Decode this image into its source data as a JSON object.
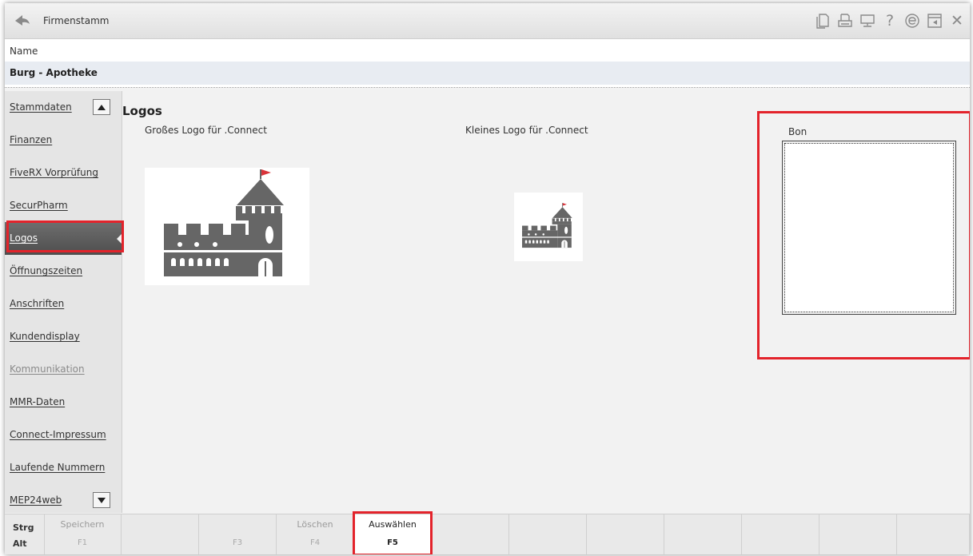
{
  "window": {
    "title": "Firmenstamm"
  },
  "toolbar_icons": [
    "document-icon",
    "print-icon",
    "monitor-icon",
    "help-icon",
    "edge-icon",
    "minimize-icon",
    "close-icon"
  ],
  "toolbar_glyphs": {
    "help": "?",
    "close": "✕"
  },
  "header": {
    "name_label": "Name",
    "name_value": "Burg - Apotheke"
  },
  "sidebar": {
    "items": [
      {
        "label": "Stammdaten"
      },
      {
        "label": "Finanzen"
      },
      {
        "label": "FiveRX Vorprüfung"
      },
      {
        "label": "SecurPharm"
      },
      {
        "label": "Logos"
      },
      {
        "label": "Öffnungszeiten"
      },
      {
        "label": "Anschriften"
      },
      {
        "label": "Kundendisplay"
      },
      {
        "label": "Kommunikation"
      },
      {
        "label": "MMR-Daten"
      },
      {
        "label": "Connect-Impressum"
      },
      {
        "label": "Laufende Nummern"
      },
      {
        "label": "MEP24web"
      }
    ],
    "active": "Logos",
    "disabled": [
      "Kommunikation"
    ]
  },
  "main": {
    "title": "Logos",
    "large_logo_label": "Großes Logo für .Connect",
    "small_logo_label": "Kleines Logo für .Connect",
    "bon_label": "Bon"
  },
  "fkeys": {
    "modifiers": [
      "Strg",
      "Alt"
    ],
    "keys": [
      {
        "label": "Speichern",
        "key": "F1",
        "enabled": false
      },
      {
        "label": "",
        "key": "",
        "enabled": false
      },
      {
        "label": "",
        "key": "F3",
        "enabled": false
      },
      {
        "label": "Löschen",
        "key": "F4",
        "enabled": false
      },
      {
        "label": "Auswählen",
        "key": "F5",
        "enabled": true
      },
      {
        "label": "",
        "key": "",
        "enabled": false
      },
      {
        "label": "",
        "key": "",
        "enabled": false
      },
      {
        "label": "",
        "key": "",
        "enabled": false
      },
      {
        "label": "",
        "key": "",
        "enabled": false
      },
      {
        "label": "",
        "key": "",
        "enabled": false
      },
      {
        "label": "",
        "key": "",
        "enabled": false
      },
      {
        "label": "",
        "key": "",
        "enabled": false
      }
    ]
  },
  "colors": {
    "accent_red": "#e3232b",
    "logo_gray": "#666666",
    "flag_red": "#d9343a",
    "active_item": "#5a5a5a"
  }
}
